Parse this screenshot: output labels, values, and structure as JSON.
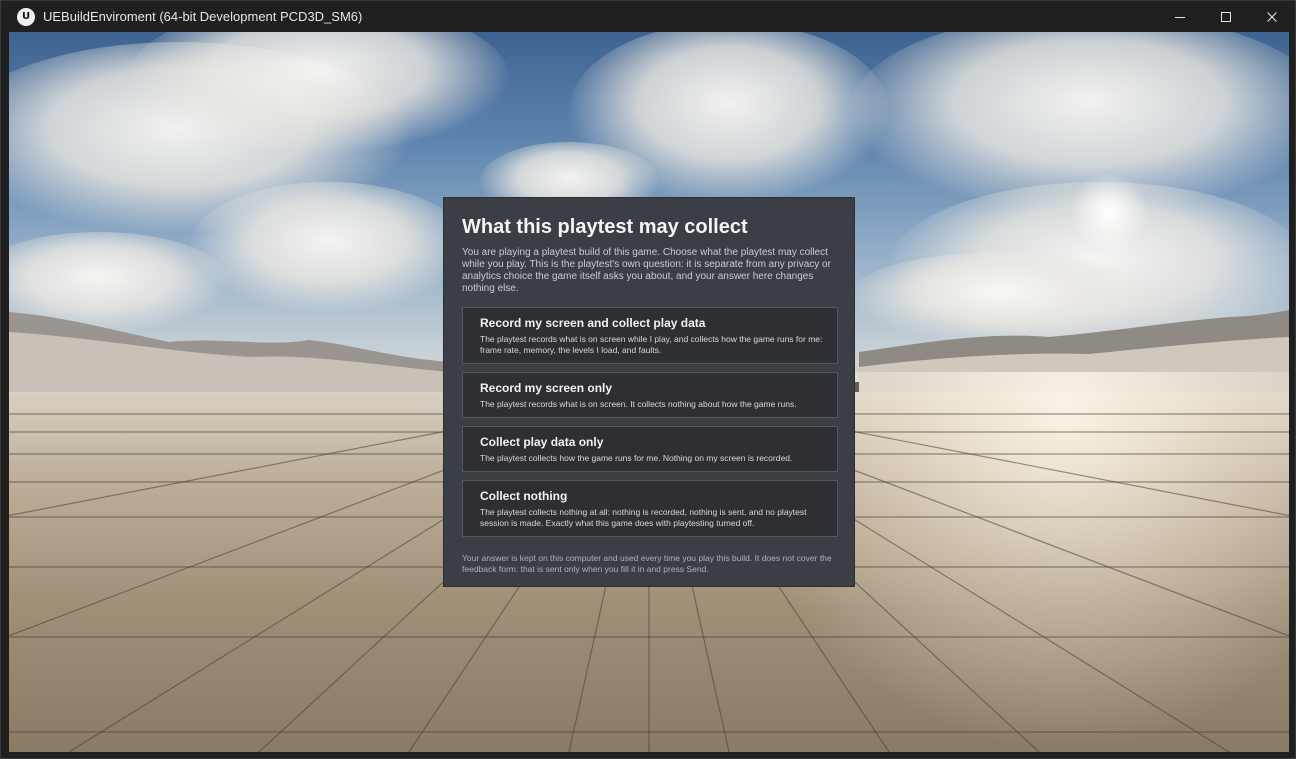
{
  "window": {
    "title": "UEBuildEnviroment (64-bit Development PCD3D_SM6)",
    "logo_glyph": "U",
    "controls": [
      "minimize-icon",
      "maximize-icon",
      "close-icon"
    ]
  },
  "dialog": {
    "title": "What this playtest may collect",
    "intro": "You are playing a playtest build of this game. Choose what the playtest may collect while you play. This is the playtest's own question: it is separate from any privacy or analytics choice the game itself asks you about, and your answer here changes nothing else.",
    "options": [
      {
        "title": "Record my screen and collect play data",
        "description": "The playtest records what is on screen while I play, and collects how the game runs for me: frame rate, memory, the levels I load, and faults."
      },
      {
        "title": "Record my screen only",
        "description": "The playtest records what is on screen. It collects nothing about how the game runs."
      },
      {
        "title": "Collect play data only",
        "description": "The playtest collects how the game runs for me. Nothing on my screen is recorded."
      },
      {
        "title": "Collect nothing",
        "description": "The playtest collects nothing at all: nothing is recorded, nothing is sent, and no playtest session is made. Exactly what this game does with playtesting turned off."
      }
    ],
    "footer": "Your answer is kept on this computer and used every time you play this build. It does not cover the feedback form: that is sent only when you fill it in and press Send."
  },
  "colors": {
    "dialog_bg": "#3b3f45",
    "option_bg": "#2d2f33",
    "titlebar_bg": "#202020"
  }
}
